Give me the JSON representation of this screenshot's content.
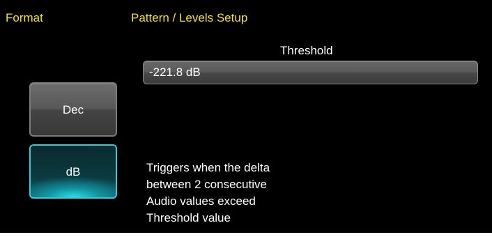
{
  "format": {
    "label": "Format",
    "buttons": {
      "dec": "Dec",
      "db": "dB"
    },
    "selected": "dB"
  },
  "pattern": {
    "label": "Pattern / Levels Setup",
    "threshold_label": "Threshold",
    "threshold_value": "-221.8 dB",
    "description_lines": [
      "Triggers when the delta",
      "between 2 consecutive",
      "Audio values exceed",
      "Threshold value"
    ]
  },
  "colors": {
    "background": "#000000",
    "section_label": "#f2e22a",
    "selected_accent": "#39c8d6"
  }
}
